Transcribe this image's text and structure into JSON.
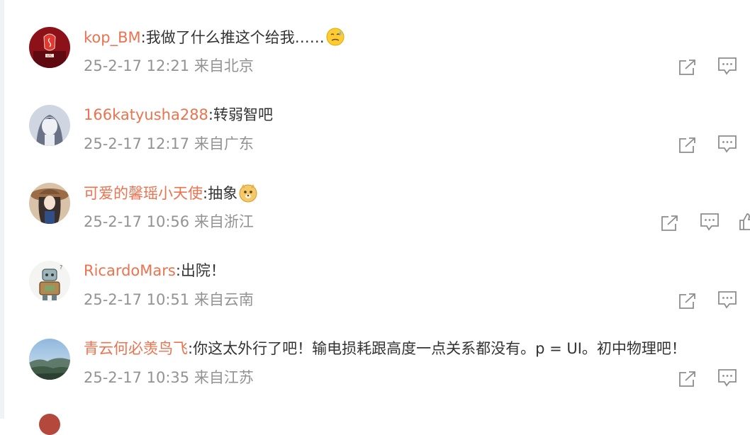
{
  "comments": [
    {
      "username": "kop_BM",
      "text": ":我做了什么推这个给我……",
      "emoji": "sweat-emoji",
      "meta": "25-2-17 12:21 来自北京",
      "avatar": "liverpool-avatar"
    },
    {
      "username": "166katyusha288",
      "text": ":转弱智吧",
      "emoji": "",
      "meta": "25-2-17 12:17 来自广东",
      "avatar": "anime-girl-avatar"
    },
    {
      "username": "可爱的馨瑶小天使",
      "text": ":抽象",
      "emoji": "doge-emoji",
      "meta": "25-2-17 10:56 来自浙江",
      "avatar": "hat-girl-avatar"
    },
    {
      "username": "RicardoMars",
      "text": ":出院！",
      "emoji": "",
      "meta": "25-2-17 10:51 来自云南",
      "avatar": "robot-avatar"
    },
    {
      "username": "青云何必羡鸟飞",
      "text": ":你这太外行了吧！输电损耗跟高度一点关系都没有。p = UI。初中物理吧！",
      "emoji": "",
      "meta": "25-2-17 10:35 来自江苏",
      "avatar": "landscape-avatar"
    }
  ],
  "icons": {
    "share": "share-icon",
    "reply": "comment-icon",
    "like": "thumbs-up-icon"
  },
  "colors": {
    "username": "#eb7350",
    "meta": "#939393",
    "text": "#333333",
    "icon": "#8d8d8d"
  }
}
